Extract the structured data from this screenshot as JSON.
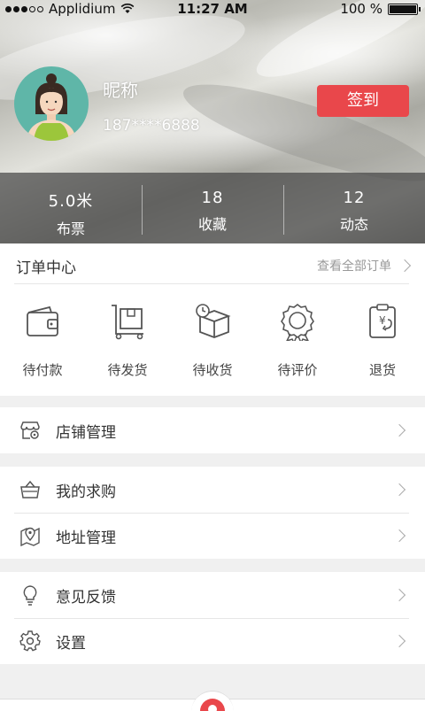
{
  "status_bar": {
    "carrier": "Applidium",
    "time": "11:27 AM",
    "battery": "100 %"
  },
  "profile": {
    "nickname": "昵称",
    "phone": "187****6888",
    "signin_label": "签到"
  },
  "stats": [
    {
      "value": "5.0米",
      "label": "布票"
    },
    {
      "value": "18",
      "label": "收藏"
    },
    {
      "value": "12",
      "label": "动态"
    }
  ],
  "orders": {
    "title": "订单中心",
    "view_all": "查看全部订单",
    "items": [
      {
        "label": "待付款",
        "icon": "wallet-icon"
      },
      {
        "label": "待发货",
        "icon": "cart-box-icon"
      },
      {
        "label": "待收货",
        "icon": "package-icon"
      },
      {
        "label": "待评价",
        "icon": "badge-icon"
      },
      {
        "label": "退货",
        "icon": "return-icon"
      }
    ]
  },
  "menu": {
    "store": {
      "label": "店铺管理",
      "icon": "store-icon"
    },
    "wanted": {
      "label": "我的求购",
      "icon": "basket-icon"
    },
    "address": {
      "label": "地址管理",
      "icon": "map-pin-icon"
    },
    "feedback": {
      "label": "意见反馈",
      "icon": "lightbulb-icon"
    },
    "settings": {
      "label": "设置",
      "icon": "gear-icon"
    }
  },
  "colors": {
    "accent": "#e9474b",
    "avatar_bg": "#5fb6a8"
  }
}
